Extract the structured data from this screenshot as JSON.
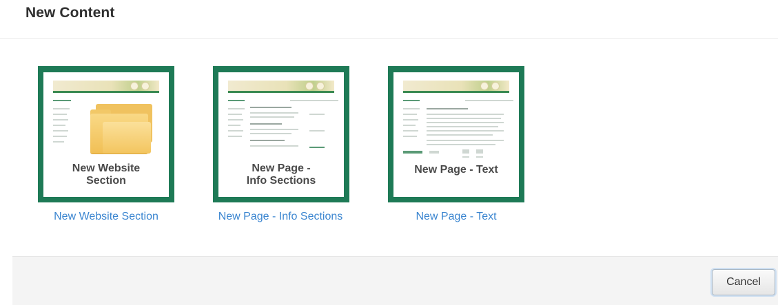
{
  "dialog": {
    "title": "New Content"
  },
  "tiles": [
    {
      "thumbnail_caption_line1": "New Website",
      "thumbnail_caption_line2": "Section",
      "link_label": "New Website Section",
      "icon": "folder-icon"
    },
    {
      "thumbnail_caption_line1": "New Page -",
      "thumbnail_caption_line2": "Info Sections",
      "link_label": "New Page - Info Sections",
      "icon": "page-info-sections-thumbnail"
    },
    {
      "thumbnail_caption_line1": "New Page - Text",
      "thumbnail_caption_line2": "",
      "link_label": "New Page - Text",
      "icon": "page-text-thumbnail"
    }
  ],
  "footer": {
    "cancel_label": "Cancel"
  },
  "colors": {
    "tile_border": "#1e7a56",
    "link": "#3a85d0",
    "folder": "#f1bf55",
    "footer_bg": "#f4f4f4"
  }
}
